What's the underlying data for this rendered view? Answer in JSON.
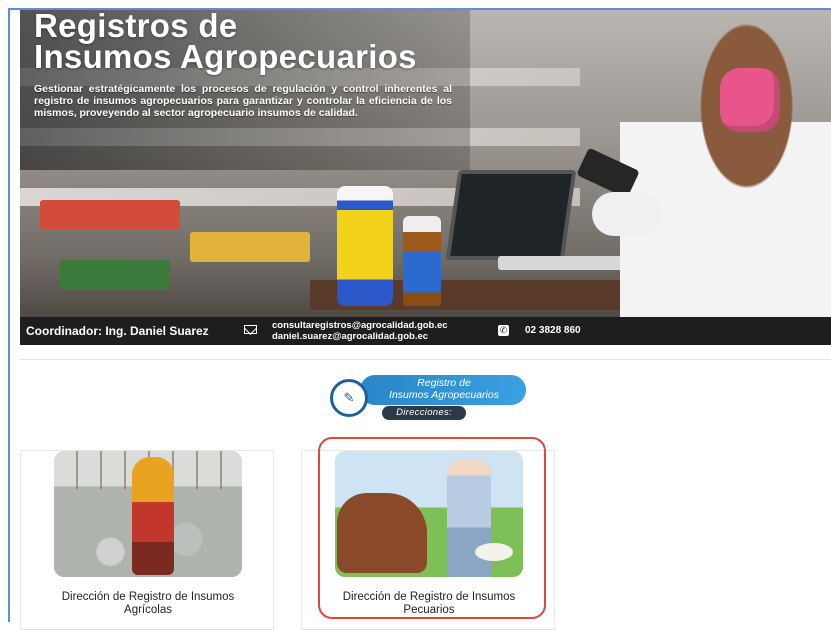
{
  "hero": {
    "title_line1": "Registros de",
    "title_line2": "Insumos Agropecuarios",
    "description": "Gestionar estratégicamente los procesos de regulación y control inherentes al registro de insumos agropecuarios para garantizar y controlar la eficiencia de los mismos, proveyendo al sector agropecuario insumos de calidad.",
    "coordinator": "Coordinador: Ing. Daniel Suarez",
    "email_1": "consultaregistros@agrocalidad.gob.ec",
    "email_2": "daniel.suarez@agrocalidad.gob.ec",
    "phone": "02 3828 860"
  },
  "badge": {
    "title_line1": "Registro de",
    "title_line2": "Insumos Agropecuarios",
    "tag": "Direcciones:"
  },
  "cards": [
    {
      "label_line1": "Dirección de Registro de Insumos",
      "label_line2": "Agrícolas"
    },
    {
      "label_line1": "Dirección de Registro de Insumos",
      "label_line2": "Pecuarios"
    }
  ],
  "colors": {
    "highlight": "#e0463a",
    "badge_blue": "#2a86c8",
    "bar_dark": "#1e1e1e"
  },
  "icons": [
    "mail-icon",
    "phone-icon",
    "registry-logo-icon"
  ]
}
